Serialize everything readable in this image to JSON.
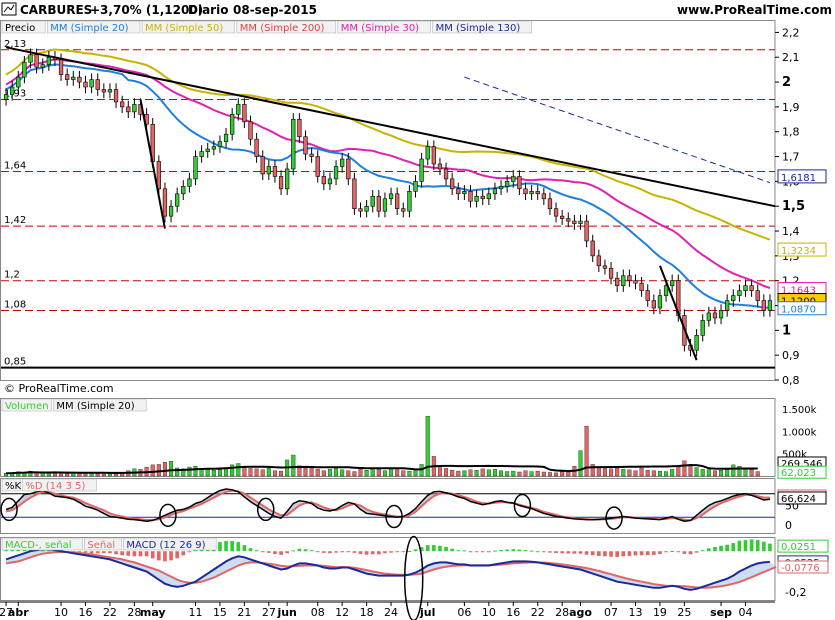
{
  "header": {
    "ticker": "CARBURES",
    "change": "+3,70% (1,1200)",
    "period": "Diario",
    "date": "08-sep-2015",
    "site": "www.ProRealTime.com"
  },
  "copyright": "© ProRealTime.com",
  "colors": {
    "up": "#33cc33",
    "down": "#e06666",
    "ma20": "#1e7fe0",
    "ma50": "#c8b400",
    "ma200": "#e04040",
    "ma30": "#e020b0",
    "ma130": "#1a2a9a",
    "trend": "#000000",
    "hline": "#cc0000"
  },
  "chart_data": [
    {
      "type": "candlestick",
      "panel": "price",
      "legend": [
        "Precio",
        "MM (Simple 20)",
        "MM (Simple 50)",
        "MM (Simple 200)",
        "MM (Simple 30)",
        "MM (Simple 130)"
      ],
      "ylim": [
        0.8,
        2.25
      ],
      "y_ticks": [
        "2,2",
        "2,1",
        "2",
        "1,9",
        "1,8",
        "1,7",
        "1,6",
        "1,5",
        "1,4",
        "1,3",
        "1,2",
        "1,1",
        "1",
        "0,9",
        "0,8"
      ],
      "y_tick_values": [
        2.2,
        2.1,
        2.0,
        1.9,
        1.8,
        1.7,
        1.6,
        1.5,
        1.4,
        1.3,
        1.2,
        1.1,
        1.0,
        0.9,
        0.8
      ],
      "bold_ticks": [
        "2",
        "1,5",
        "1"
      ],
      "level_lines": [
        2.13,
        1.93,
        1.64,
        1.42,
        1.2,
        1.08,
        0.85
      ],
      "level_labels": [
        "2,13",
        "1,93",
        "1,64",
        "1,42",
        "1,2",
        "1,08",
        "0,85"
      ],
      "price_tags": [
        {
          "label": "1,6181",
          "value": 1.6181,
          "color": "#1a2a9a"
        },
        {
          "label": "1,3234",
          "value": 1.3234,
          "color": "#c8b400"
        },
        {
          "label": "1,1643",
          "value": 1.1643,
          "color": "#e020b0"
        },
        {
          "label": "1,1200",
          "value": 1.12,
          "color": "#000000",
          "fill": "#ffcc00"
        },
        {
          "label": "1,0870",
          "value": 1.087,
          "color": "#1e7fe0"
        }
      ],
      "x_labels": [
        {
          "label": "27",
          "index": 0
        },
        {
          "label": "abr",
          "index": 2,
          "bold": true
        },
        {
          "label": "10",
          "index": 9
        },
        {
          "label": "16",
          "index": 13
        },
        {
          "label": "22",
          "index": 17
        },
        {
          "label": "28",
          "index": 21
        },
        {
          "label": "may",
          "index": 24,
          "bold": true
        },
        {
          "label": "11",
          "index": 31
        },
        {
          "label": "15",
          "index": 35
        },
        {
          "label": "21",
          "index": 39
        },
        {
          "label": "27",
          "index": 43
        },
        {
          "label": "jun",
          "index": 46,
          "bold": true
        },
        {
          "label": "08",
          "index": 51
        },
        {
          "label": "12",
          "index": 55
        },
        {
          "label": "18",
          "index": 59
        },
        {
          "label": "24",
          "index": 63
        },
        {
          "label": "jul",
          "index": 69,
          "bold": true
        },
        {
          "label": "06",
          "index": 75
        },
        {
          "label": "10",
          "index": 79
        },
        {
          "label": "16",
          "index": 83
        },
        {
          "label": "22",
          "index": 87
        },
        {
          "label": "28",
          "index": 91
        },
        {
          "label": "ago",
          "index": 94,
          "bold": true
        },
        {
          "label": "07",
          "index": 99
        },
        {
          "label": "13",
          "index": 103
        },
        {
          "label": "19",
          "index": 107
        },
        {
          "label": "25",
          "index": 111
        },
        {
          "label": "sep",
          "index": 117,
          "bold": true
        },
        {
          "label": "04",
          "index": 121
        }
      ],
      "close": [
        1.95,
        1.98,
        2.02,
        2.08,
        2.11,
        2.06,
        2.07,
        2.1,
        2.09,
        2.03,
        2.01,
        2.02,
        2.0,
        1.98,
        2.01,
        1.97,
        1.96,
        1.97,
        1.92,
        1.9,
        1.88,
        1.91,
        1.87,
        1.83,
        1.68,
        1.57,
        1.46,
        1.5,
        1.55,
        1.58,
        1.61,
        1.7,
        1.72,
        1.73,
        1.74,
        1.76,
        1.79,
        1.87,
        1.91,
        1.84,
        1.77,
        1.7,
        1.63,
        1.66,
        1.62,
        1.57,
        1.65,
        1.85,
        1.78,
        1.71,
        1.7,
        1.62,
        1.59,
        1.61,
        1.66,
        1.69,
        1.61,
        1.49,
        1.48,
        1.5,
        1.54,
        1.48,
        1.53,
        1.55,
        1.49,
        1.48,
        1.56,
        1.6,
        1.69,
        1.74,
        1.67,
        1.65,
        1.61,
        1.57,
        1.55,
        1.56,
        1.52,
        1.54,
        1.53,
        1.55,
        1.57,
        1.58,
        1.6,
        1.62,
        1.57,
        1.55,
        1.56,
        1.55,
        1.53,
        1.49,
        1.46,
        1.45,
        1.44,
        1.43,
        1.44,
        1.36,
        1.3,
        1.26,
        1.25,
        1.21,
        1.18,
        1.22,
        1.2,
        1.19,
        1.16,
        1.12,
        1.09,
        1.14,
        1.18,
        1.2,
        1.06,
        0.94,
        0.92,
        0.98,
        1.04,
        1.07,
        1.05,
        1.08,
        1.12,
        1.14,
        1.16,
        1.18,
        1.16,
        1.12,
        1.08,
        1.12
      ],
      "volume": [
        60,
        70,
        95,
        80,
        110,
        65,
        70,
        80,
        95,
        60,
        55,
        70,
        65,
        60,
        75,
        50,
        45,
        60,
        55,
        75,
        120,
        160,
        150,
        200,
        250,
        260,
        310,
        330,
        180,
        160,
        200,
        220,
        170,
        150,
        130,
        140,
        190,
        250,
        280,
        220,
        170,
        160,
        140,
        180,
        120,
        110,
        360,
        470,
        230,
        180,
        170,
        150,
        120,
        150,
        170,
        140,
        120,
        100,
        150,
        130,
        160,
        150,
        120,
        180,
        140,
        120,
        110,
        160,
        260,
        1340,
        440,
        230,
        170,
        130,
        110,
        120,
        140,
        130,
        160,
        140,
        150,
        120,
        100,
        110,
        90,
        120,
        100,
        110,
        90,
        80,
        70,
        100,
        90,
        220,
        570,
        1120,
        260,
        200,
        170,
        160,
        180,
        150,
        140,
        120,
        180,
        130,
        120,
        110,
        100,
        150,
        220,
        340,
        260,
        190,
        150,
        140,
        120,
        130,
        150,
        250,
        220,
        160,
        140,
        100
      ],
      "volume_axis": [
        "1.500k",
        "1.000k",
        "500k"
      ],
      "volume_axis_values": [
        1500,
        1000,
        500
      ],
      "volume_legend": [
        "Volumen",
        "MM (Simple 20)"
      ],
      "volume_tags": [
        {
          "label": "269,546",
          "value": 269.546,
          "color": "#000000"
        },
        {
          "label": "62,023",
          "value": 62.023,
          "color": "#33cc33"
        }
      ]
    },
    {
      "type": "line",
      "panel": "stochastic",
      "legend": [
        "%K",
        "%D (14 3 5)"
      ],
      "ylim": [
        -20,
        120
      ],
      "y_ticks": [
        "50",
        "0"
      ],
      "y_tick_values": [
        50,
        0
      ],
      "levels": [
        80,
        20
      ],
      "tags": [
        {
          "label": "71,669",
          "value": 71.669,
          "color": "#e06666"
        },
        {
          "label": "66,624",
          "value": 66.624,
          "color": "#000000"
        }
      ],
      "circles": [
        0,
        26,
        42,
        63,
        84,
        99
      ],
      "k": [
        40,
        45,
        62,
        78,
        80,
        85,
        88,
        82,
        74,
        72,
        70,
        66,
        58,
        48,
        44,
        38,
        30,
        22,
        20,
        18,
        15,
        14,
        12,
        10,
        12,
        18,
        25,
        32,
        38,
        40,
        46,
        55,
        60,
        70,
        80,
        88,
        92,
        90,
        85,
        72,
        60,
        50,
        40,
        30,
        22,
        18,
        35,
        55,
        62,
        60,
        55,
        44,
        38,
        36,
        40,
        50,
        58,
        54,
        40,
        30,
        28,
        26,
        24,
        22,
        20,
        22,
        30,
        42,
        60,
        76,
        85,
        86,
        82,
        78,
        72,
        68,
        60,
        56,
        52,
        55,
        60,
        62,
        58,
        56,
        50,
        46,
        42,
        36,
        30,
        26,
        22,
        20,
        18,
        16,
        15,
        14,
        14,
        15,
        16,
        18,
        20,
        22,
        20,
        18,
        17,
        16,
        15,
        14,
        18,
        22,
        15,
        10,
        12,
        25,
        38,
        50,
        58,
        62,
        68,
        74,
        78,
        80,
        76,
        70,
        64,
        66
      ],
      "d": [
        35,
        38,
        48,
        60,
        70,
        78,
        84,
        84,
        80,
        76,
        72,
        70,
        64,
        56,
        50,
        44,
        38,
        30,
        25,
        22,
        19,
        17,
        15,
        13,
        13,
        15,
        20,
        26,
        32,
        36,
        42,
        48,
        54,
        62,
        70,
        78,
        85,
        88,
        86,
        80,
        70,
        60,
        50,
        40,
        32,
        25,
        26,
        38,
        50,
        56,
        58,
        52,
        45,
        40,
        38,
        43,
        50,
        54,
        50,
        40,
        34,
        30,
        27,
        24,
        22,
        21,
        25,
        34,
        48,
        62,
        74,
        80,
        82,
        80,
        76,
        72,
        66,
        60,
        56,
        55,
        57,
        59,
        58,
        56,
        52,
        48,
        44,
        40,
        34,
        30,
        26,
        22,
        20,
        18,
        16,
        15,
        14,
        14,
        15,
        16,
        18,
        20,
        20,
        19,
        18,
        17,
        16,
        15,
        16,
        18,
        17,
        14,
        12,
        18,
        27,
        38,
        48,
        56,
        62,
        68,
        73,
        77,
        77,
        74,
        70,
        70
      ]
    },
    {
      "type": "line",
      "panel": "macd",
      "legend": [
        "MACD-, señal",
        "Señal",
        "MACD (12 26 9)"
      ],
      "ylim": [
        -0.24,
        0.07
      ],
      "y_ticks": [
        "-0,2"
      ],
      "y_tick_values": [
        -0.2
      ],
      "tags": [
        {
          "label": "0,0251",
          "value": 0.0251,
          "color": "#33cc33"
        },
        {
          "label": "-0,0525",
          "value": -0.0525,
          "color": "#1a2a9a"
        },
        {
          "label": "-0,0776",
          "value": -0.0776,
          "color": "#e06666"
        }
      ],
      "ellipse_index": 69,
      "macd": [
        -0.04,
        -0.03,
        -0.02,
        -0.01,
        0.0,
        0.005,
        0.01,
        0.01,
        0.005,
        0.0,
        -0.005,
        -0.01,
        -0.015,
        -0.02,
        -0.025,
        -0.03,
        -0.035,
        -0.04,
        -0.05,
        -0.06,
        -0.07,
        -0.08,
        -0.09,
        -0.1,
        -0.12,
        -0.14,
        -0.16,
        -0.17,
        -0.175,
        -0.17,
        -0.16,
        -0.15,
        -0.13,
        -0.11,
        -0.09,
        -0.07,
        -0.05,
        -0.035,
        -0.025,
        -0.03,
        -0.04,
        -0.05,
        -0.06,
        -0.07,
        -0.08,
        -0.09,
        -0.085,
        -0.07,
        -0.06,
        -0.06,
        -0.065,
        -0.07,
        -0.08,
        -0.085,
        -0.085,
        -0.08,
        -0.08,
        -0.09,
        -0.1,
        -0.11,
        -0.115,
        -0.12,
        -0.12,
        -0.12,
        -0.12,
        -0.12,
        -0.115,
        -0.105,
        -0.09,
        -0.07,
        -0.06,
        -0.055,
        -0.055,
        -0.06,
        -0.065,
        -0.065,
        -0.07,
        -0.07,
        -0.07,
        -0.07,
        -0.065,
        -0.06,
        -0.055,
        -0.05,
        -0.05,
        -0.05,
        -0.052,
        -0.055,
        -0.06,
        -0.065,
        -0.07,
        -0.075,
        -0.08,
        -0.085,
        -0.09,
        -0.1,
        -0.11,
        -0.12,
        -0.13,
        -0.14,
        -0.15,
        -0.155,
        -0.16,
        -0.165,
        -0.17,
        -0.175,
        -0.18,
        -0.18,
        -0.175,
        -0.17,
        -0.175,
        -0.185,
        -0.19,
        -0.185,
        -0.175,
        -0.165,
        -0.155,
        -0.145,
        -0.135,
        -0.12,
        -0.1,
        -0.085,
        -0.07,
        -0.06,
        -0.055,
        -0.0525
      ],
      "signal": [
        -0.06,
        -0.055,
        -0.05,
        -0.04,
        -0.03,
        -0.02,
        -0.012,
        -0.008,
        -0.005,
        -0.004,
        -0.004,
        -0.006,
        -0.008,
        -0.012,
        -0.015,
        -0.02,
        -0.025,
        -0.03,
        -0.035,
        -0.04,
        -0.048,
        -0.055,
        -0.065,
        -0.075,
        -0.085,
        -0.095,
        -0.11,
        -0.125,
        -0.14,
        -0.15,
        -0.155,
        -0.155,
        -0.15,
        -0.14,
        -0.13,
        -0.115,
        -0.1,
        -0.085,
        -0.07,
        -0.06,
        -0.055,
        -0.055,
        -0.058,
        -0.062,
        -0.066,
        -0.072,
        -0.075,
        -0.074,
        -0.072,
        -0.07,
        -0.07,
        -0.07,
        -0.072,
        -0.075,
        -0.078,
        -0.078,
        -0.079,
        -0.082,
        -0.087,
        -0.093,
        -0.1,
        -0.105,
        -0.11,
        -0.113,
        -0.115,
        -0.116,
        -0.116,
        -0.114,
        -0.11,
        -0.1,
        -0.09,
        -0.082,
        -0.076,
        -0.072,
        -0.07,
        -0.069,
        -0.069,
        -0.069,
        -0.069,
        -0.069,
        -0.068,
        -0.066,
        -0.063,
        -0.06,
        -0.058,
        -0.056,
        -0.055,
        -0.055,
        -0.056,
        -0.058,
        -0.061,
        -0.065,
        -0.069,
        -0.073,
        -0.078,
        -0.083,
        -0.09,
        -0.097,
        -0.105,
        -0.113,
        -0.122,
        -0.13,
        -0.137,
        -0.144,
        -0.15,
        -0.156,
        -0.162,
        -0.166,
        -0.17,
        -0.171,
        -0.171,
        -0.172,
        -0.175,
        -0.178,
        -0.18,
        -0.179,
        -0.176,
        -0.172,
        -0.167,
        -0.16,
        -0.152,
        -0.14,
        -0.128,
        -0.115,
        -0.102,
        -0.09,
        -0.0776
      ]
    }
  ]
}
